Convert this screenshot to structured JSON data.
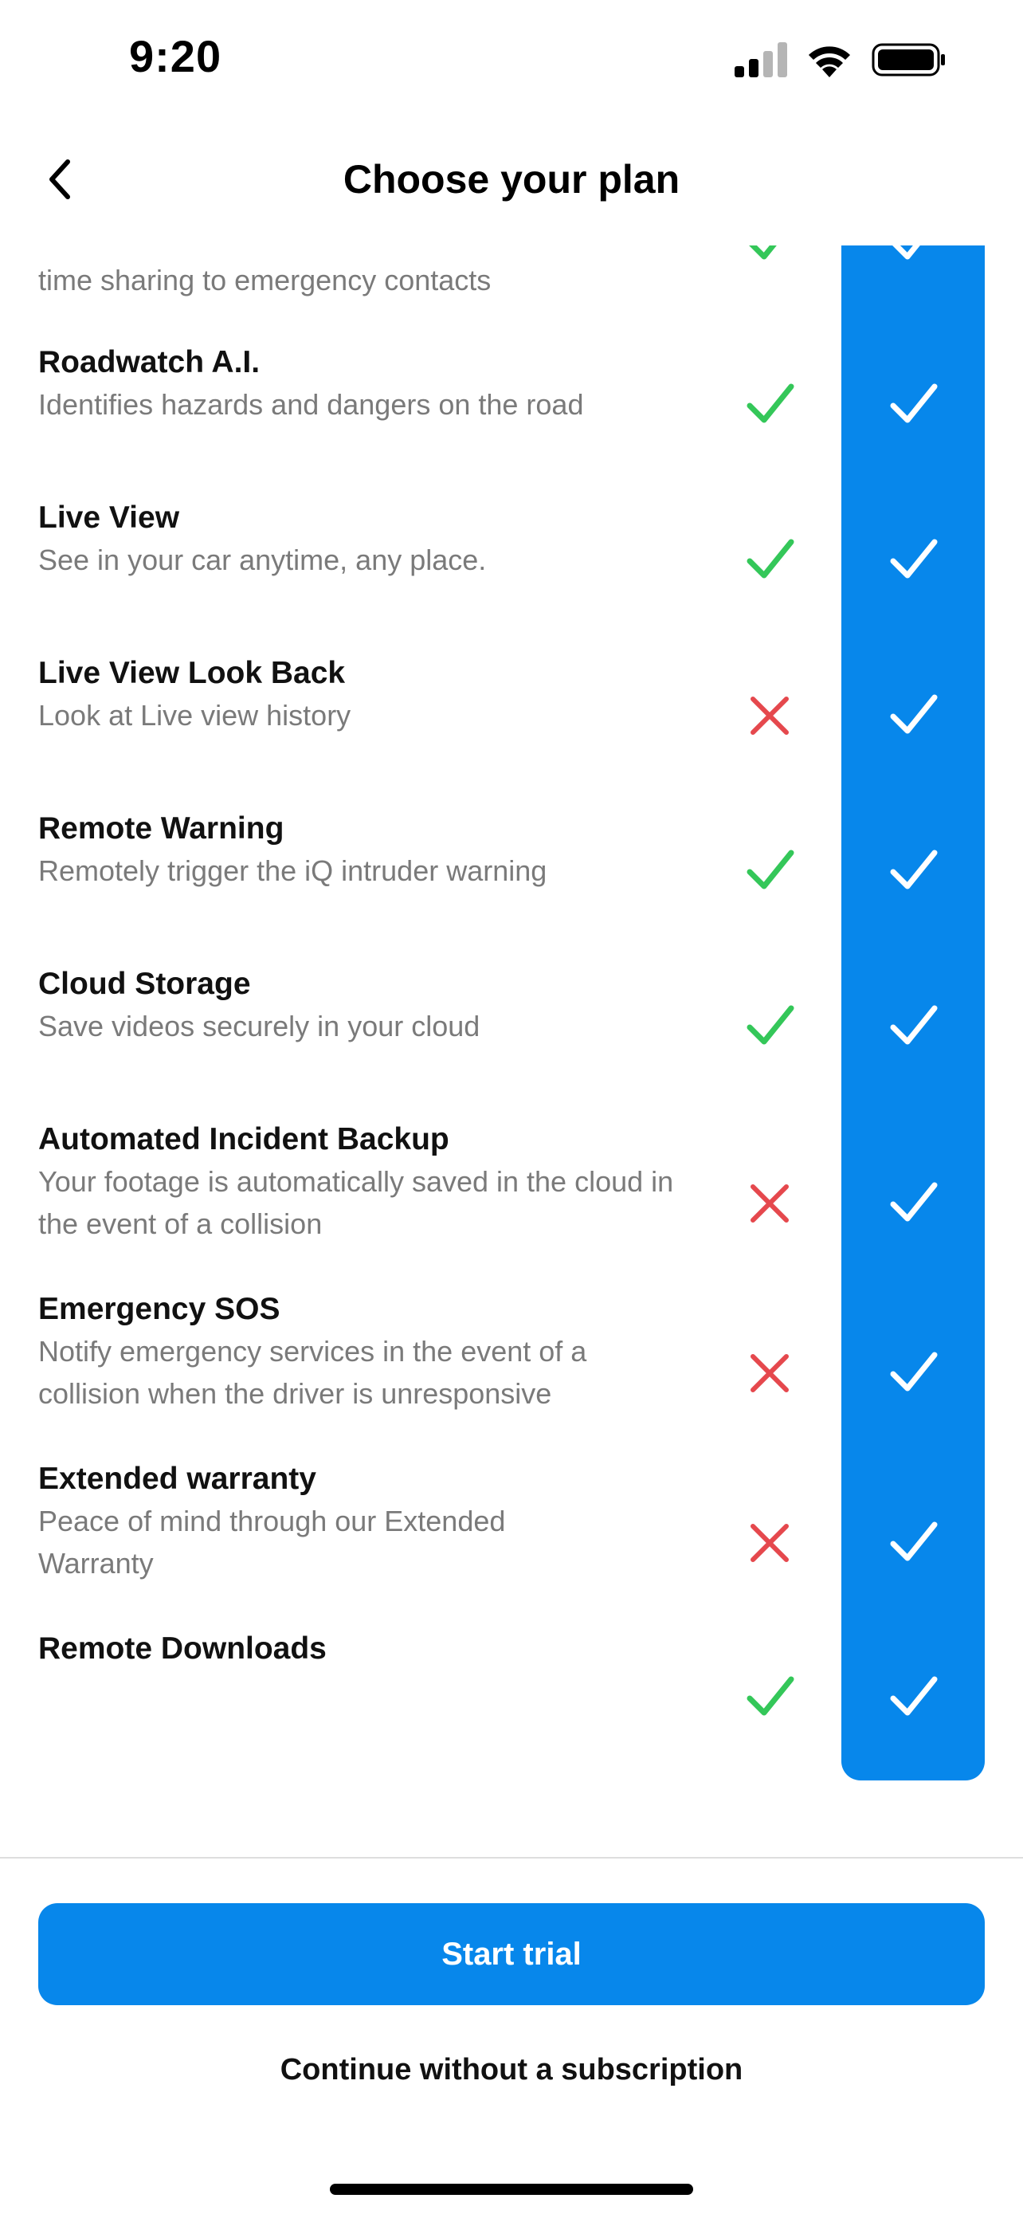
{
  "status": {
    "time": "9:20"
  },
  "header": {
    "title": "Choose your plan"
  },
  "colors": {
    "accent": "#0787EB",
    "check": "#34C759",
    "cross": "#E5484D"
  },
  "features": [
    {
      "title": "",
      "description": "time sharing to emergency contacts",
      "basic": "check",
      "premium": "check"
    },
    {
      "title": "Roadwatch A.I.",
      "description": "Identifies hazards and dangers on the road",
      "basic": "check",
      "premium": "check"
    },
    {
      "title": "Live View",
      "description": "See in your car anytime, any place.",
      "basic": "check",
      "premium": "check"
    },
    {
      "title": "Live View Look Back",
      "description": "Look at Live view history",
      "basic": "cross",
      "premium": "check"
    },
    {
      "title": "Remote Warning",
      "description": "Remotely trigger the iQ intruder warning",
      "basic": "check",
      "premium": "check"
    },
    {
      "title": "Cloud Storage",
      "description": "Save videos securely in your cloud",
      "basic": "check",
      "premium": "check"
    },
    {
      "title": "Automated Incident Backup",
      "description": "Your footage is automatically saved in the cloud in the event of a collision",
      "basic": "cross",
      "premium": "check"
    },
    {
      "title": "Emergency SOS",
      "description": "Notify emergency services in the event of a collision when the driver is unresponsive",
      "basic": "cross",
      "premium": "check"
    },
    {
      "title": "Extended warranty",
      "description": "Peace of mind through our Extended Warranty",
      "basic": "cross",
      "premium": "check"
    },
    {
      "title": "Remote Downloads",
      "description": "",
      "basic": "check",
      "premium": "check"
    }
  ],
  "actions": {
    "start_trial_label": "Start trial",
    "continue_label": "Continue without a subscription"
  }
}
